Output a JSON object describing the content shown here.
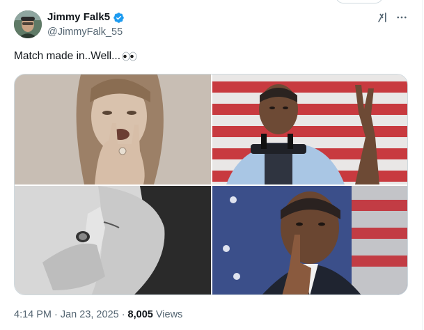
{
  "author": {
    "display_name": "Jimmy Falk5",
    "handle": "@JimmyFalk_55",
    "verified": true
  },
  "tweet": {
    "text": "Match made in..Well..."
  },
  "media": [
    {
      "subject": "woman making rock-on hand sign, sepia"
    },
    {
      "subject": "man at podium making rock-on hand sign, flag background"
    },
    {
      "subject": "woman with finger on lips, black and white"
    },
    {
      "subject": "man with finger on lips, flag background"
    }
  ],
  "meta": {
    "time": "4:14 PM",
    "separator1": "·",
    "date": "Jan 23, 2025",
    "separator2": "·",
    "views_count": "8,005",
    "views_label": "Views"
  },
  "colors": {
    "text_primary": "#0f1419",
    "text_secondary": "#536471",
    "verified_blue": "#1d9bf0",
    "border": "#cfd9de"
  },
  "icons": [
    "verified-badge-icon",
    "grok-icon",
    "more-icon",
    "eyes-emoji-icon"
  ]
}
